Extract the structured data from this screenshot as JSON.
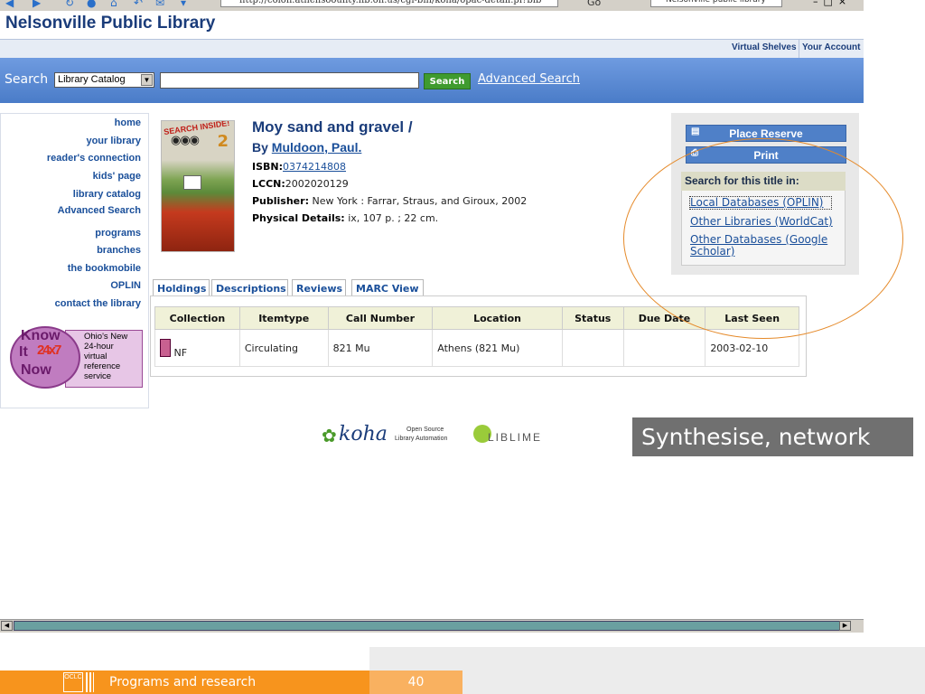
{
  "browser": {
    "address": "http://colon.athensoounty.lib.oh.us/cgi-bin/koha/opac-detail.pl?bib",
    "go_label": "Go",
    "search_box": "Nelsonville public library"
  },
  "site": {
    "title": "Nelsonville Public Library"
  },
  "top_links": {
    "virtual_shelves": "Virtual Shelves",
    "your_account": "Your Account"
  },
  "search": {
    "label": "Search",
    "scope": "Library Catalog",
    "query": "",
    "button": "Search",
    "advanced": "Advanced Search"
  },
  "nav": {
    "items": [
      "home",
      "your library",
      "reader's connection",
      "kids' page",
      "library catalog",
      "Advanced Search",
      "programs",
      "branches",
      "the bookmobile",
      "OPLIN",
      "contact the library"
    ]
  },
  "badge": {
    "know": "Know",
    "it": "It",
    "num": "24x7",
    "now": "Now",
    "lines": [
      "Ohio's New",
      "24-hour",
      "virtual",
      "reference",
      "service"
    ]
  },
  "cover": {
    "banner": "SEARCH INSIDE!",
    "number": "2"
  },
  "book": {
    "title": "Moy sand and gravel /",
    "by_label": "By",
    "author": "Muldoon, Paul.",
    "isbn_label": "ISBN:",
    "isbn": "0374214808",
    "lccn_label": "LCCN:",
    "lccn": "2002020129",
    "publisher_label": "Publisher:",
    "publisher": "New York : Farrar, Straus, and Giroux, 2002",
    "physical_label": "Physical Details:",
    "physical": "ix, 107 p. ; 22 cm."
  },
  "actions": {
    "reserve": "Place Reserve",
    "print": "Print",
    "search_heading": "Search for this title in:",
    "links": [
      "Local Databases (OPLIN)",
      "Other Libraries (WorldCat)",
      "Other Databases (Google Scholar)"
    ]
  },
  "tabs": [
    "Holdings",
    "Descriptions",
    "Reviews",
    "MARC View"
  ],
  "holdings": {
    "columns": [
      "Collection",
      "Itemtype",
      "Call Number",
      "Location",
      "Status",
      "Due Date",
      "Last Seen"
    ],
    "rows": [
      {
        "collection": "NF",
        "itemtype": "Circulating",
        "call_number": "821 Mu",
        "location": "Athens (821 Mu)",
        "status": "",
        "due_date": "",
        "last_seen": "2003-02-10"
      }
    ]
  },
  "footer": {
    "koha": "koha",
    "koha_sub1": "Open Source",
    "koha_sub2": "Library Automation",
    "liblime": "LIBLIME"
  },
  "overlay": {
    "text": "Synthesise, network"
  },
  "slide": {
    "section": "Programs and research",
    "page": "40",
    "logo": "OCLC"
  },
  "colors": {
    "accent_blue": "#1a3c7a",
    "search_bar": "#5a8ad4",
    "orange": "#f7941d",
    "oval": "#e58a2a"
  }
}
